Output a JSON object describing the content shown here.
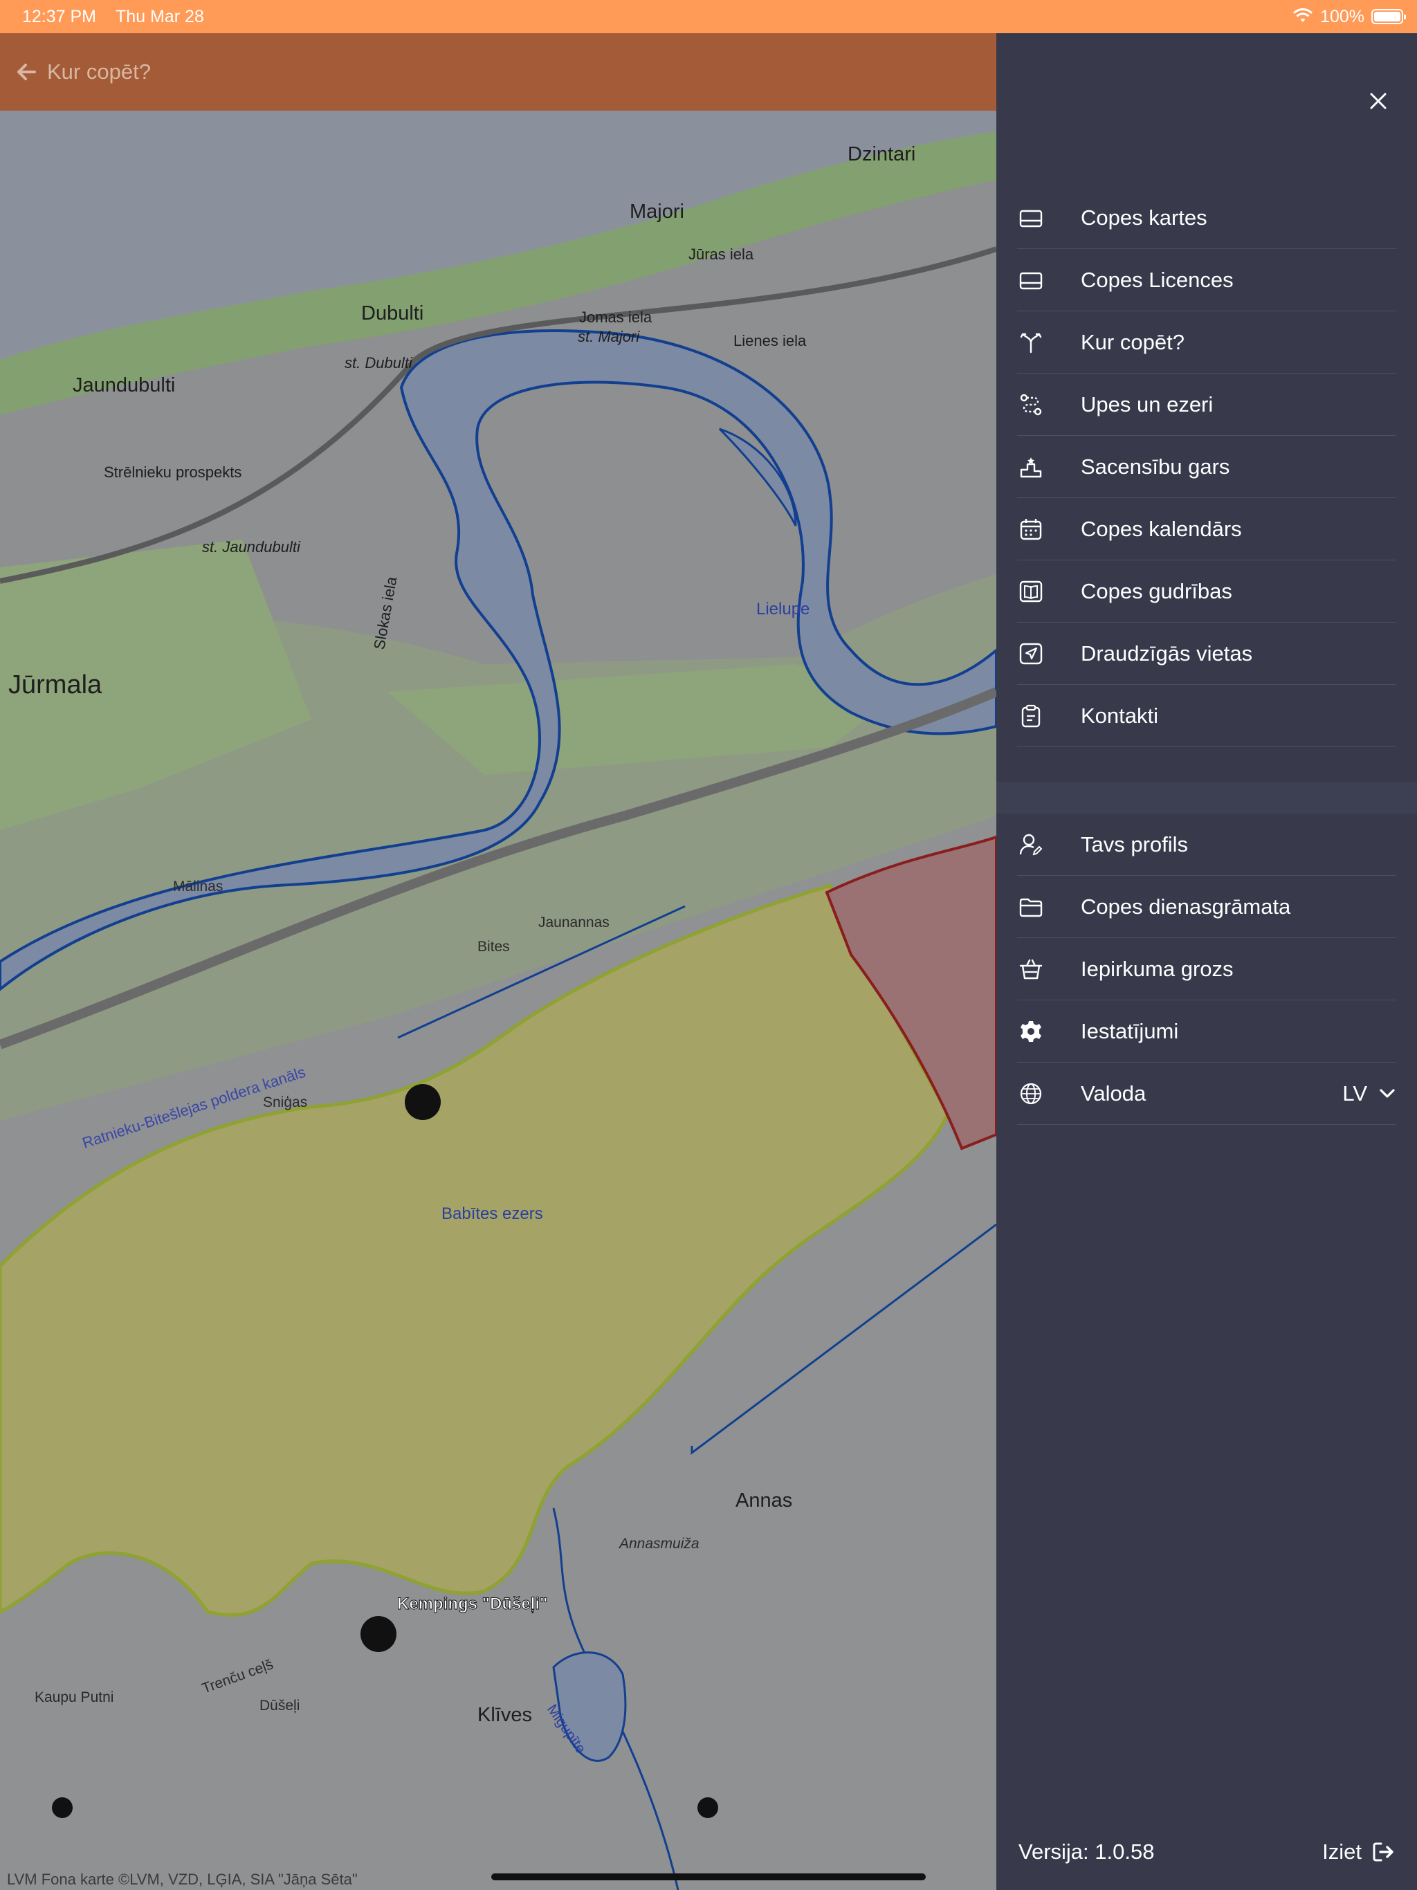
{
  "status_bar": {
    "time": "12:37 PM",
    "date": "Thu Mar 28",
    "battery": "100%",
    "battery_level": 1.0
  },
  "app_bar": {
    "title": "Kur copēt?"
  },
  "map": {
    "labels": {
      "dzintari": "Dzintari",
      "majori": "Majori",
      "dubulti": "Dubulti",
      "jaundubulti": "Jaundubulti",
      "st_dubulti": "st. Dubulti",
      "st_majori": "st. Majori",
      "st_jaundubulti": "st. Jaundubulti",
      "jurmala": "Jūrmala",
      "lielupe": "Lielupe",
      "babites_ezers": "Babītes ezers",
      "kempings": "Kempings \"Dūšeļi\"",
      "annas": "Annas",
      "klives": "Klīves",
      "jomas_iela": "Jomas iela",
      "juras_iela": "Jūras iela",
      "lienes_iela": "Lienes iela",
      "strelnieku_prospekts": "Strēlnieku prospekts",
      "slokas_iela": "Slokas iela",
      "ratnieku_kanals": "Ratnieku-Bitešlejas poldera kanāls",
      "annasmuiza": "Annasmuiža",
      "migupite": "Migupīte",
      "malinas": "Mālinas",
      "jaunannas": "Jaunannas",
      "bites": "Bites",
      "snigas": "Sniģas",
      "dusjeli": "Dūšeļi",
      "trencu_cels": "Trenču ceļš",
      "kaupu_putni": "Kaupu Putni"
    },
    "attribution": "LVM Fona karte ©LVM, VZD, LĢIA, SIA \"Jāņa Sēta\""
  },
  "drawer": {
    "menu_main": [
      {
        "label": "Copes kartes",
        "icon": "card-icon"
      },
      {
        "label": "Copes Licences",
        "icon": "license-icon"
      },
      {
        "label": "Kur copēt?",
        "icon": "fork-icon"
      },
      {
        "label": "Upes un ezeri",
        "icon": "route-icon"
      },
      {
        "label": "Sacensību gars",
        "icon": "podium-icon"
      },
      {
        "label": "Copes kalendārs",
        "icon": "calendar-icon"
      },
      {
        "label": "Copes gudrības",
        "icon": "book-icon"
      },
      {
        "label": "Draudzīgās vietas",
        "icon": "location-arrow-icon"
      },
      {
        "label": "Kontakti",
        "icon": "clipboard-icon"
      }
    ],
    "menu_account": [
      {
        "label": "Tavs profils",
        "icon": "user-edit-icon"
      },
      {
        "label": "Copes dienasgrāmata",
        "icon": "folder-icon"
      },
      {
        "label": "Iepirkuma grozs",
        "icon": "basket-icon"
      },
      {
        "label": "Iestatījumi",
        "icon": "gear-icon"
      },
      {
        "label": "Valoda",
        "icon": "globe-icon",
        "value": "LV"
      }
    ],
    "version": "Versija: 1.0.58",
    "logout": "Iziet"
  }
}
